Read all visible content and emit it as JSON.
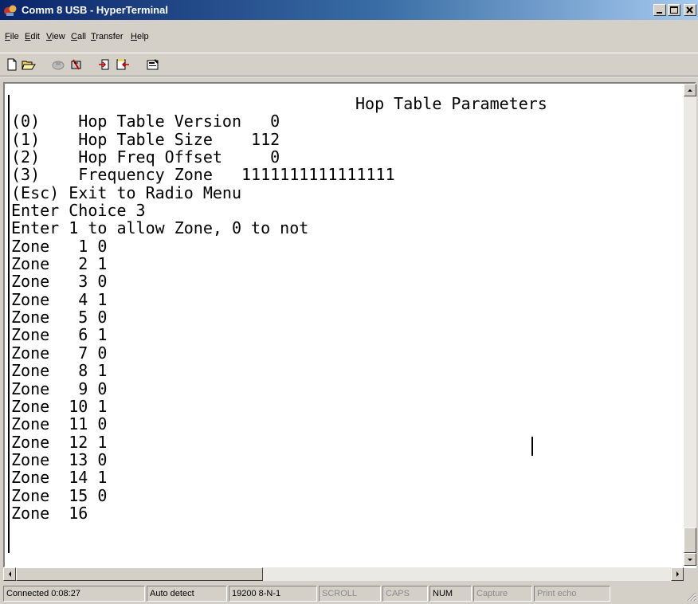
{
  "window": {
    "title": "Comm 8 USB - HyperTerminal",
    "icon": "hyperterminal-app-icon",
    "controls": [
      "minimize-icon",
      "maximize-icon",
      "close-icon"
    ]
  },
  "menu": [
    "File",
    "Edit",
    "View",
    "Call",
    "Transfer",
    "Help"
  ],
  "toolbar": {
    "buttons": [
      "new-connection-icon",
      "open-folder-icon",
      "connect-icon",
      "disconnect-icon",
      "send-icon",
      "receive-icon",
      "properties-icon"
    ]
  },
  "terminal": {
    "title": "Hop Table Parameters",
    "lines": [
      "(0)    Hop Table Version   0",
      "(1)    Hop Table Size    112",
      "(2)    Hop Freq Offset     0",
      "(3)    Frequency Zone   1111111111111111",
      "(Esc) Exit to Radio Menu",
      "Enter Choice 3",
      "Enter 1 to allow Zone, 0 to not",
      "Zone   1 0",
      "Zone   2 1",
      "Zone   3 0",
      "Zone   4 1",
      "Zone   5 0",
      "Zone   6 1",
      "Zone   7 0",
      "Zone   8 1",
      "Zone   9 0",
      "Zone  10 1",
      "Zone  11 0",
      "Zone  12 1",
      "Zone  13 0",
      "Zone  14 1",
      "Zone  15 0",
      "Zone  16"
    ]
  },
  "status": {
    "connected": "Connected 0:08:27",
    "detect": "Auto detect",
    "port_settings": "19200 8-N-1",
    "scroll": "SCROLL",
    "caps": "CAPS",
    "num": "NUM",
    "capture": "Capture",
    "print_echo": "Print echo"
  }
}
